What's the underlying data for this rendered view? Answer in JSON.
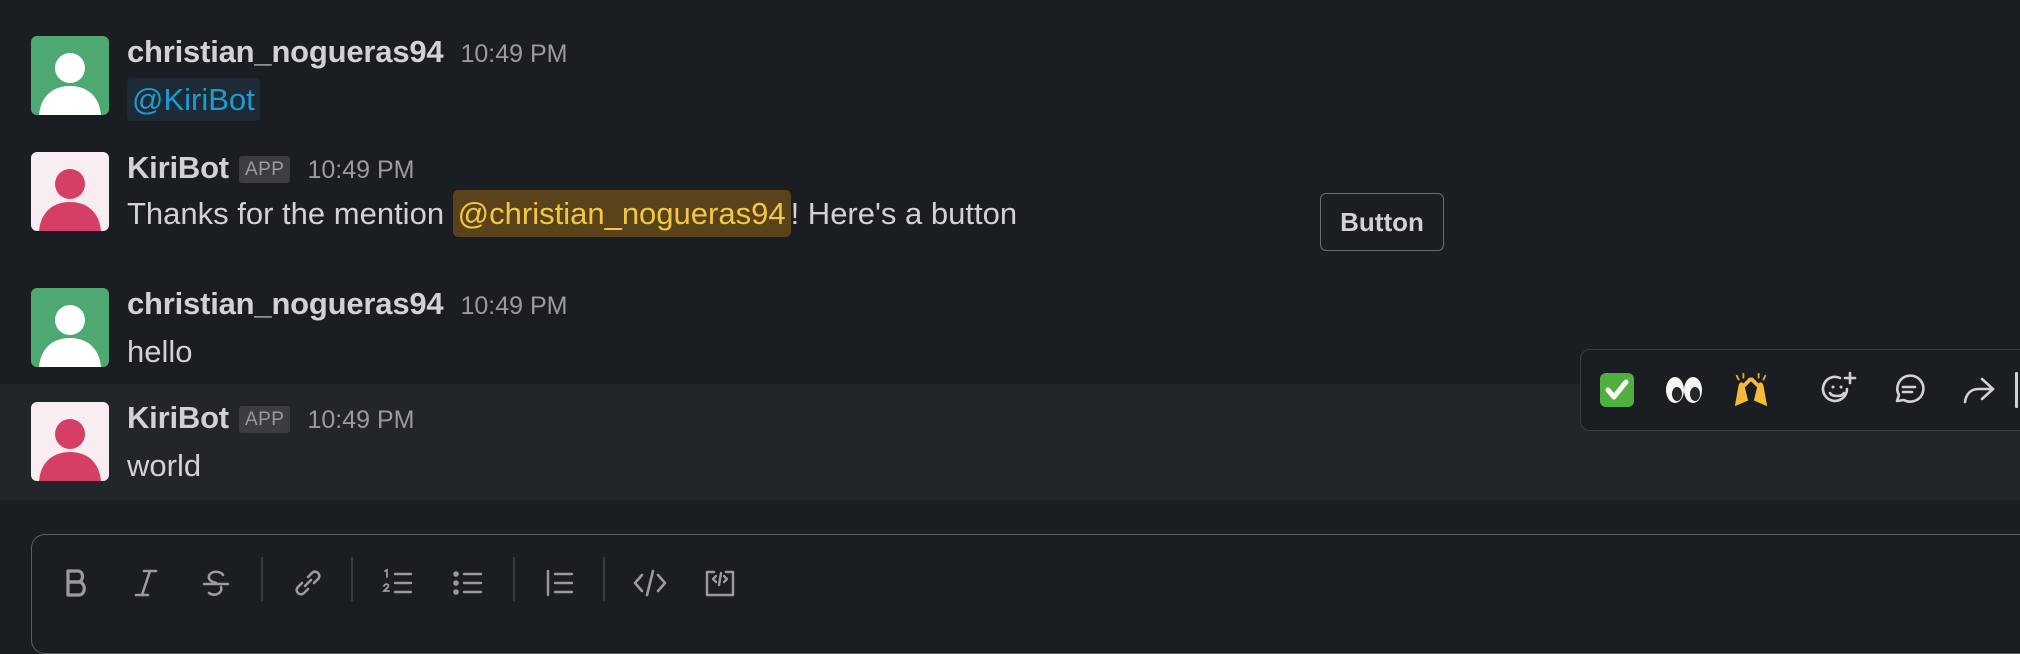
{
  "messages": [
    {
      "user": "christian_nogueras94",
      "time": "10:49 PM",
      "mention": "@KiriBot"
    },
    {
      "user": "KiriBot",
      "badge": "APP",
      "time": "10:49 PM",
      "text_before": "Thanks for the mention ",
      "mention": "@christian_nogueras94",
      "text_after": "! Here's a button",
      "button_label": "Button"
    },
    {
      "user": "christian_nogueras94",
      "time": "10:49 PM",
      "text": "hello"
    },
    {
      "user": "KiriBot",
      "badge": "APP",
      "time": "10:49 PM",
      "text": "world"
    }
  ],
  "hover_actions": {
    "emoji_1": "✅",
    "emoji_2": "👀",
    "emoji_3": "🙌",
    "icons": [
      "add-reaction-icon",
      "reply-in-thread-icon",
      "share-message-icon"
    ]
  },
  "composer_toolbar": {
    "icons": [
      "bold-icon",
      "italic-icon",
      "strikethrough-icon",
      "link-icon",
      "ordered-list-icon",
      "bulleted-list-icon",
      "blockquote-icon",
      "code-icon",
      "code-block-icon"
    ]
  },
  "colors": {
    "background": "#1a1d21",
    "hover_row": "#222529",
    "human_avatar": "#4ea872",
    "bot_avatar": "#d53f66",
    "mention_blue": "#1d9bd1",
    "mention_yellow": "#f2c744"
  }
}
